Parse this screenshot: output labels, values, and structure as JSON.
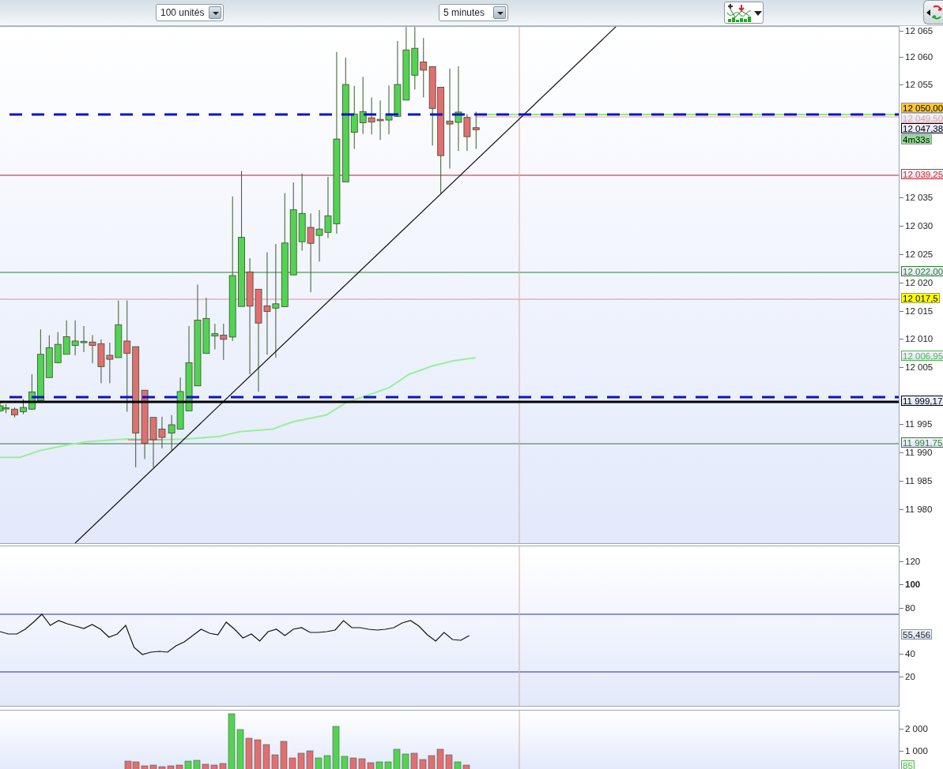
{
  "toolbar": {
    "quantity_select": {
      "value": "100 unités"
    },
    "timeframe_select": {
      "value": "5 minutes"
    }
  },
  "price_pane": {
    "axis_labels": [
      "12 065",
      "12 060",
      "12 055",
      "12 035",
      "12 030",
      "12 025",
      "12 020",
      "12 015",
      "12 010",
      "12 005",
      "11 995",
      "11 990",
      "11 985",
      "11 980"
    ],
    "price_tags": [
      {
        "text": "12 050,00",
        "kind": "filled",
        "color": "#ffc830"
      },
      {
        "text": "12 049,50",
        "kind": "outlined",
        "color": "#e8a0a0"
      },
      {
        "text": "12 047,38",
        "kind": "outlined",
        "color": "#000000"
      },
      {
        "text": "4m33s",
        "kind": "filled",
        "color": "#90e090"
      },
      {
        "text": "12 039,25",
        "kind": "outlined",
        "color": "#e02828"
      },
      {
        "text": "12 022,00",
        "kind": "outlined",
        "color": "#2e7d32"
      },
      {
        "text": "12 017,5",
        "kind": "filled",
        "color": "#ffff00"
      },
      {
        "text": "12 006,95",
        "kind": "outlined",
        "color": "#4fb84f"
      },
      {
        "text": "11 999,17",
        "kind": "outlined",
        "color": "#000000"
      },
      {
        "text": "11 991,75",
        "kind": "outlined",
        "color": "#2e7d32"
      }
    ]
  },
  "rsi_pane": {
    "axis_labels": [
      {
        "text": "120",
        "bold": false
      },
      {
        "text": "100",
        "bold": true
      },
      {
        "text": "80",
        "bold": false
      },
      {
        "text": "40",
        "bold": false
      },
      {
        "text": "20",
        "bold": false
      }
    ],
    "value_tag": {
      "text": "55,456"
    }
  },
  "volume_pane": {
    "axis_labels": [
      "2 000",
      "1 000"
    ],
    "value_tag": {
      "text": "85",
      "color": "#5cb85c"
    }
  }
}
